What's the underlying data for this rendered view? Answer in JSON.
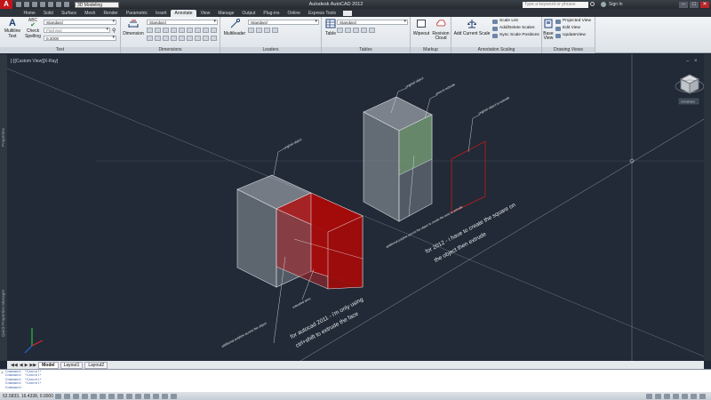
{
  "titlebar": {
    "workspace": "3D Modeling",
    "title": "Autodesk AutoCAD 2012 Drawing1.dwg",
    "search_placeholder": "Type a keyword or phrase",
    "signin": "Sign In"
  },
  "tabs": [
    "Home",
    "Solid",
    "Surface",
    "Mesh",
    "Render",
    "Parametric",
    "Insert",
    "Annotate",
    "View",
    "Manage",
    "Output",
    "Plug-ins",
    "Online",
    "Express Tools"
  ],
  "ribbon": {
    "text": {
      "multiline": "Multiline\nText",
      "check_spelling": "Check\nSpelling",
      "style": "Standard",
      "find": "Find text",
      "height": "0.2000",
      "title": "Text"
    },
    "dimensions": {
      "dimension": "Dimension",
      "style": "Standard",
      "title": "Dimensions"
    },
    "leaders": {
      "multileader": "Multileader",
      "style": "Standard",
      "title": "Leaders"
    },
    "tables": {
      "table": "Table",
      "style": "Standard",
      "title": "Tables"
    },
    "markup": {
      "wipeout": "Wipeout",
      "revision_cloud": "Revision\nCloud",
      "title": "Markup"
    },
    "annotation_scaling": {
      "add_current_scale": "Add Current Scale",
      "scale_list": "Scale List",
      "add_delete_scales": "Add/Delete Scales",
      "sync_scale_positions": "Sync Scale Positions",
      "title": "Annotation Scaling"
    },
    "drawing_views": {
      "base_view": "Base\nView",
      "projected_view": "Projected View",
      "edit_view": "Edit View",
      "update_view": "UpdateView",
      "title": "Drawing Views"
    }
  },
  "viewport": {
    "label": "[-][Custom View][X-Ray]",
    "viewcube_label": "Unnamed",
    "left_palette": "Properties",
    "left_palette2": "Quick Properties Manager",
    "annotations": {
      "original_object_left": "original object",
      "original_object_right": "original object",
      "area_to_extrude": "area to extrude",
      "original_object_to_extrude": "original object to extrude",
      "additional_polyline_left": "additional polyline across the object",
      "extruded_area": "extruded area",
      "additional_polyline_right": "additional polyline across the object to create the area to extrude",
      "note_2011": "for autocad 2011 - i'm only using\nctrl+shift to extrude the face",
      "note_2012": "for 2012 - i have to create the square on\nthe object then extrude"
    }
  },
  "layout_tabs": [
    "Model",
    "Layout1",
    "Layout2"
  ],
  "command_lines": [
    "Command: *Cancel*",
    "Command: *Cancel*",
    "Command: *Cancel*",
    "Command: *Cancel*",
    "Command:"
  ],
  "status": {
    "coords": "52.5833, 16.4338, 0.0000"
  }
}
